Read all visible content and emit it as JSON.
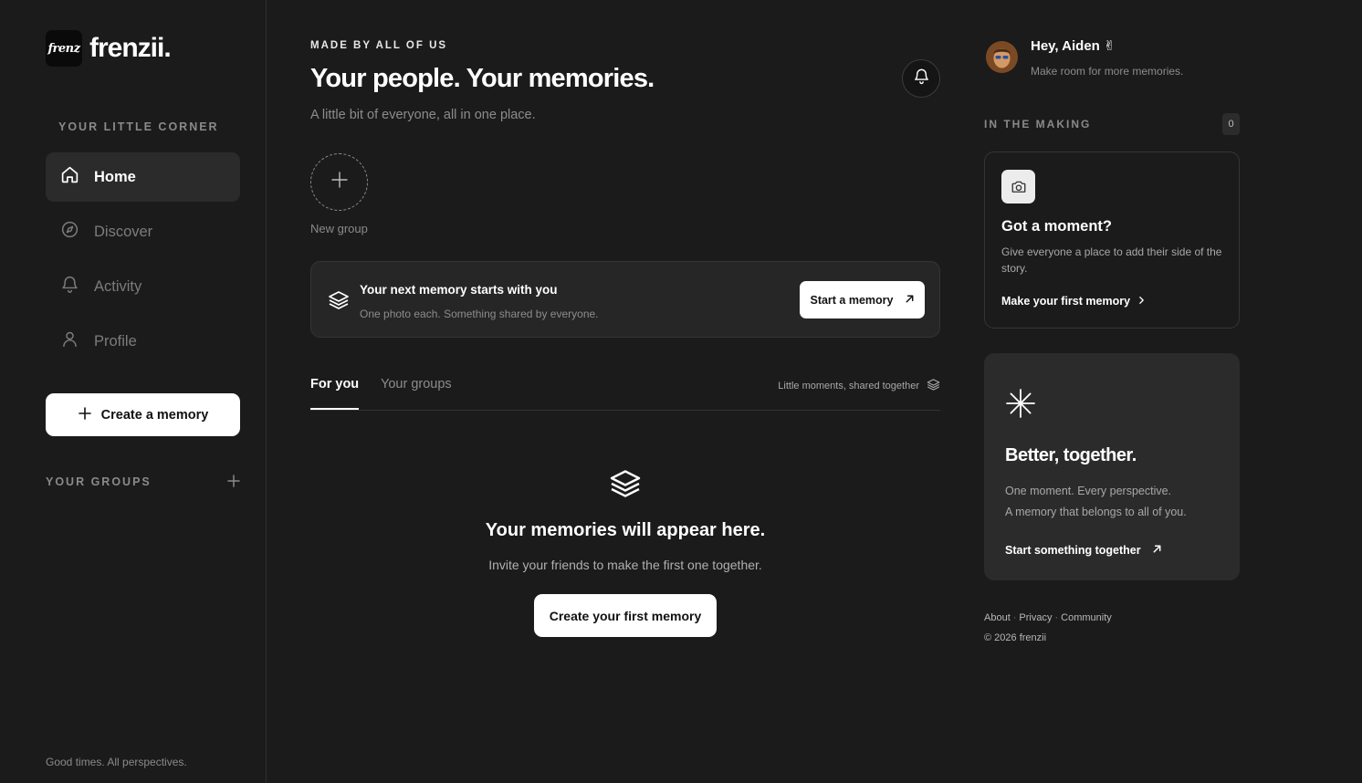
{
  "brand": {
    "badge_text": "frenz",
    "wordmark": "frenzii."
  },
  "sidebar": {
    "section_label": "YOUR LITTLE CORNER",
    "items": [
      {
        "label": "Home",
        "icon": "home-icon",
        "active": true
      },
      {
        "label": "Discover",
        "icon": "compass-icon",
        "active": false
      },
      {
        "label": "Activity",
        "icon": "bell-icon",
        "active": false
      },
      {
        "label": "Profile",
        "icon": "user-icon",
        "active": false
      }
    ],
    "create_button": "Create a memory",
    "groups_label": "YOUR GROUPS",
    "tagline": "Good times. All perspectives."
  },
  "main": {
    "eyebrow": "MADE BY ALL OF US",
    "title": "Your people. Your memories.",
    "subtitle": "A little bit of everyone, all in one place.",
    "new_group_label": "New group",
    "banner": {
      "title": "Your next memory starts with you",
      "subtitle": "One photo each. Something shared by everyone.",
      "button": "Start a memory"
    },
    "tabs": [
      {
        "label": "For you",
        "active": true
      },
      {
        "label": "Your groups",
        "active": false
      }
    ],
    "tabs_note": "Little moments, shared together",
    "empty_state": {
      "title": "Your memories will appear here.",
      "text": "Invite your friends to make the first one together.",
      "button": "Create your first memory"
    }
  },
  "right": {
    "greeting": "Hey, Aiden ✌",
    "greeting_sub": "Make room for more memories.",
    "in_making_label": "IN THE MAKING",
    "in_making_count": "0",
    "moment_card": {
      "title": "Got a moment?",
      "text": "Give everyone a place to add their side of the story.",
      "link": "Make your first memory"
    },
    "better_card": {
      "title": "Better, together.",
      "line1": "One moment. Every perspective.",
      "line2": "A memory that belongs to all of you.",
      "link": "Start something together"
    },
    "footer": {
      "about": "About",
      "privacy": "Privacy",
      "community": "Community",
      "copyright": "© 2026 frenzii"
    }
  },
  "colors": {
    "background": "#1b1b1b",
    "card": "#262626",
    "accent": "#ffffff",
    "muted": "#8c8c8c"
  }
}
